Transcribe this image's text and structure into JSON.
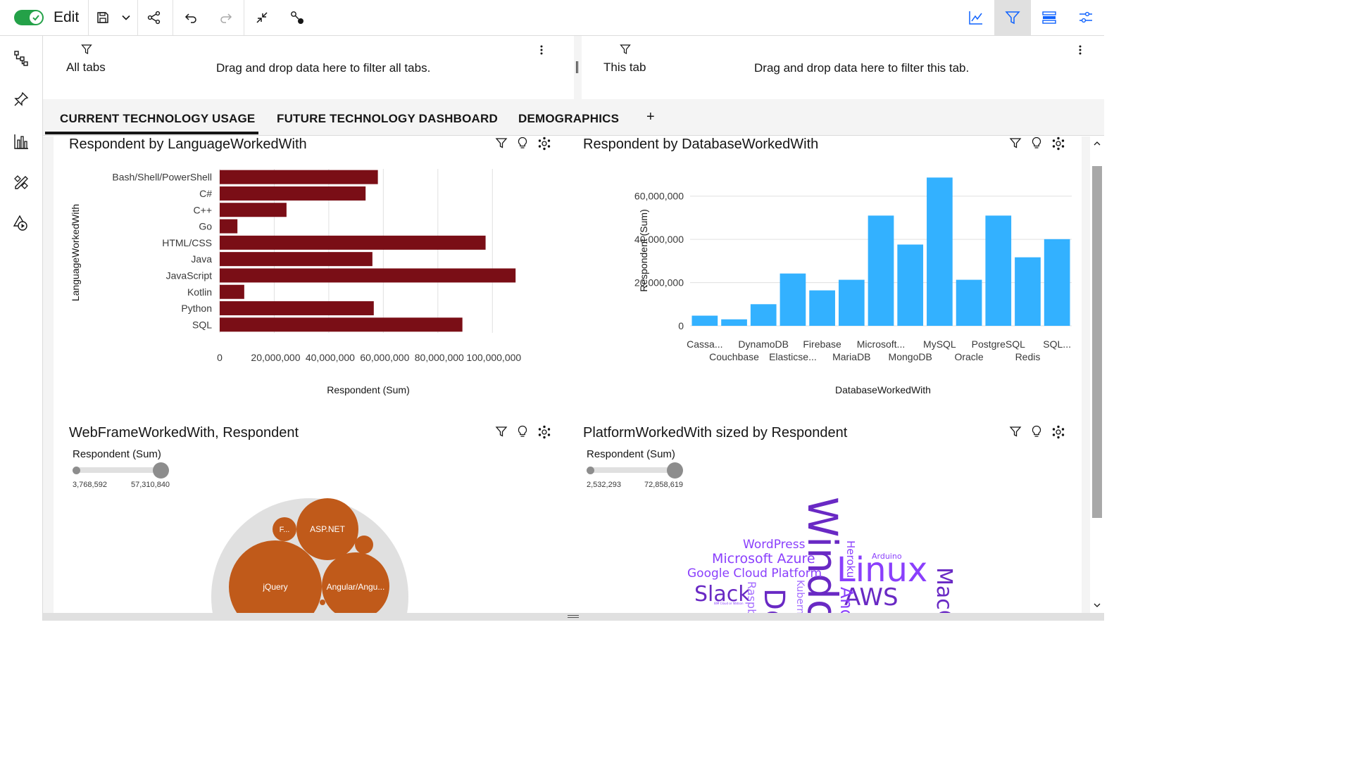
{
  "toolbar": {
    "edit_label": "Edit",
    "icons": [
      "toggle-on",
      "save-icon",
      "chevron-down-icon",
      "share-icon",
      "undo-icon",
      "redo-icon",
      "collapse-icon",
      "pointer-icon",
      "line-chart-icon",
      "filter-icon",
      "data-panel-icon",
      "properties-icon"
    ]
  },
  "sidebar": {
    "icons": [
      "tree-icon",
      "pin-icon",
      "bar-chart-icon",
      "tools-icon",
      "shapes-icon"
    ]
  },
  "filters": {
    "all_tabs": {
      "title": "All tabs",
      "hint": "Drag and drop data here to filter all tabs."
    },
    "this_tab": {
      "title": "This tab",
      "hint": "Drag and drop data here to filter this tab."
    }
  },
  "tabs": [
    {
      "label": "CURRENT TECHNOLOGY USAGE",
      "active": true
    },
    {
      "label": "FUTURE TECHNOLOGY DASHBOARD",
      "active": false
    },
    {
      "label": "DEMOGRAPHICS",
      "active": false
    }
  ],
  "add_tab_label": "+",
  "widgets": {
    "lang": {
      "title": "Respondent by LanguageWorkedWith"
    },
    "db": {
      "title": "Respondent by DatabaseWorkedWith"
    },
    "web": {
      "title": "WebFrameWorkedWith, Respondent",
      "legend_label": "Respondent (Sum)",
      "legend_min": "3,768,592",
      "legend_max": "57,310,840"
    },
    "platform": {
      "title": "PlatformWorkedWith sized by Respondent",
      "legend_label": "Respondent (Sum)",
      "legend_min": "2,532,293",
      "legend_max": "72,858,619"
    }
  },
  "chart_data": [
    {
      "type": "bar",
      "orientation": "horizontal",
      "title": "Respondent by LanguageWorkedWith",
      "xlabel": "Respondent (Sum)",
      "ylabel": "LanguageWorkedWith",
      "categories": [
        "Bash/Shell/PowerShell",
        "C#",
        "C++",
        "Go",
        "HTML/CSS",
        "Java",
        "JavaScript",
        "Kotlin",
        "Python",
        "SQL"
      ],
      "values": [
        58000000,
        53500000,
        24500000,
        6500000,
        97500000,
        56000000,
        108500000,
        9000000,
        56500000,
        89000000
      ],
      "xticks": [
        "0",
        "20,000,000",
        "40,000,000",
        "60,000,000",
        "80,000,000",
        "100,000,000"
      ],
      "xlim": [
        0,
        110000000
      ],
      "color": "#7a0e16",
      "grid": true
    },
    {
      "type": "bar",
      "title": "Respondent by DatabaseWorkedWith",
      "xlabel": "DatabaseWorkedWith",
      "ylabel": "Respondent (Sum)",
      "categories": [
        "Cassa...",
        "Couchbase",
        "DynamoDB",
        "Elasticse...",
        "Firebase",
        "MariaDB",
        "Microsoft...",
        "MongoDB",
        "MySQL",
        "Oracle",
        "PostgreSQL",
        "Redis",
        "SQL..."
      ],
      "values": [
        4700000,
        3000000,
        10000000,
        24200000,
        16400000,
        21300000,
        51000000,
        37600000,
        68600000,
        21300000,
        51000000,
        31700000,
        40100000
      ],
      "yticks": [
        "0",
        "20,000,000",
        "40,000,000",
        "60,000,000"
      ],
      "ylim": [
        0,
        70000000
      ],
      "color": "#33b1ff",
      "grid": true
    },
    {
      "type": "bubble",
      "title": "WebFrameWorkedWith, Respondent",
      "labels": [
        "jQuery",
        "Angular/Angu...",
        "ASP.NET",
        "F...",
        "",
        ""
      ],
      "values": [
        57310840,
        32000000,
        25000000,
        4500000,
        3768592,
        3768592
      ],
      "color_range": [
        "#e6a06a",
        "#c05a1a"
      ]
    },
    {
      "type": "wordcloud",
      "title": "PlatformWorkedWith sized by Respondent",
      "words": [
        "Windows",
        "Linux",
        "Docker",
        "AWS",
        "Slack",
        "MacOS",
        "Android",
        "Google Cloud Platform",
        "Microsoft Azure",
        "WordPress",
        "Heroku",
        "Kubernetes",
        "Raspberry Pi",
        "Arduino",
        "IBM Cloud or Watson"
      ]
    }
  ]
}
